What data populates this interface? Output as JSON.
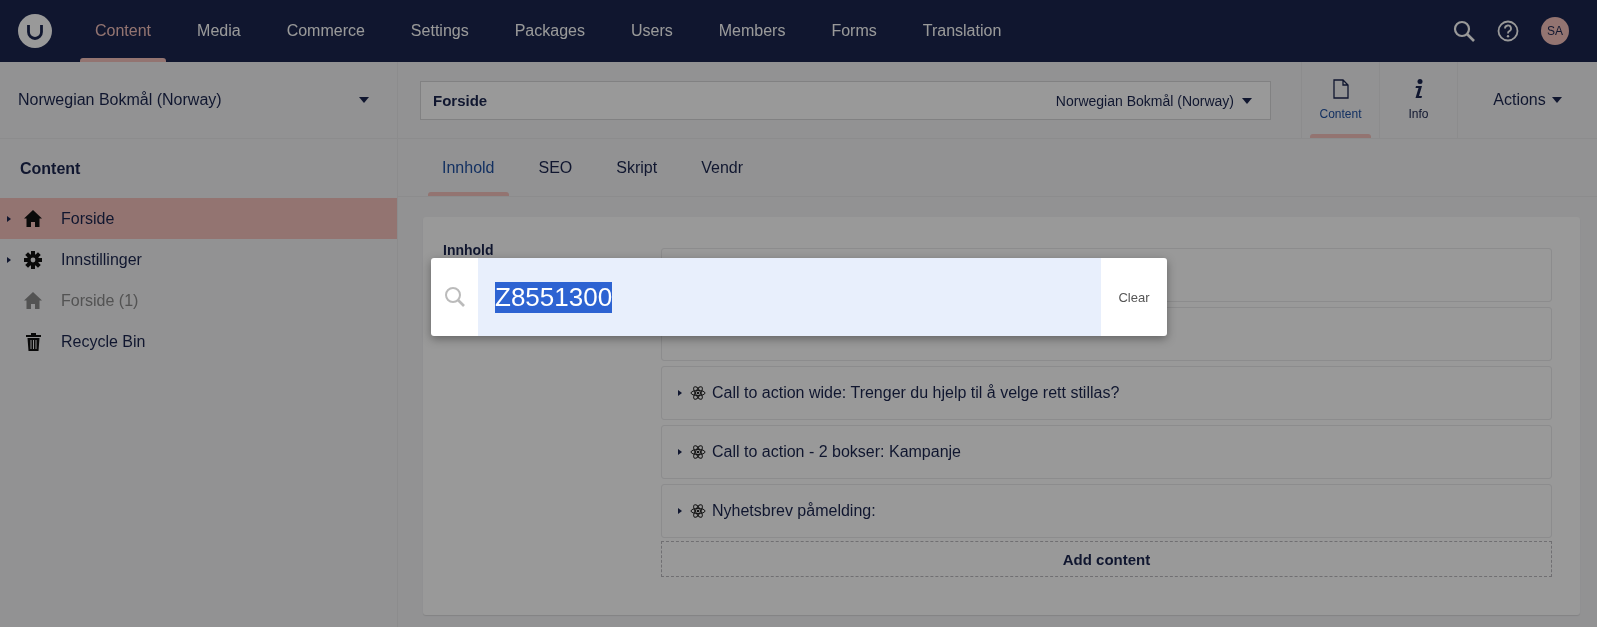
{
  "top_nav": {
    "items": [
      {
        "label": "Content",
        "selected": true
      },
      {
        "label": "Media",
        "selected": false
      },
      {
        "label": "Commerce",
        "selected": false
      },
      {
        "label": "Settings",
        "selected": false
      },
      {
        "label": "Packages",
        "selected": false
      },
      {
        "label": "Users",
        "selected": false
      },
      {
        "label": "Members",
        "selected": false
      },
      {
        "label": "Forms",
        "selected": false
      },
      {
        "label": "Translation",
        "selected": false
      }
    ],
    "avatar": "SA"
  },
  "sidebar": {
    "language": "Norwegian Bokmål (Norway)",
    "title": "Content",
    "tree": [
      {
        "label": "Forside",
        "kind": "home",
        "expandable": true,
        "selected": true,
        "muted": false
      },
      {
        "label": "Innstillinger",
        "kind": "settings",
        "expandable": true,
        "selected": false,
        "muted": false
      },
      {
        "label": "Forside (1)",
        "kind": "home",
        "expandable": false,
        "selected": false,
        "muted": true
      },
      {
        "label": "Recycle Bin",
        "kind": "trash",
        "expandable": false,
        "selected": false,
        "muted": false
      }
    ]
  },
  "editor": {
    "name": "Forside",
    "culture": "Norwegian Bokmål (Norway)",
    "apps": [
      {
        "label": "Content",
        "kind": "document",
        "selected": true
      },
      {
        "label": "Info",
        "kind": "info",
        "selected": false
      }
    ],
    "actions": "Actions",
    "tabs": [
      {
        "label": "Innhold",
        "selected": true
      },
      {
        "label": "SEO",
        "selected": false
      },
      {
        "label": "Skript",
        "selected": false
      },
      {
        "label": "Vendr",
        "selected": false
      }
    ],
    "property_label": "Innhold",
    "blocks": [
      {
        "label": "Call to action wide: Trenger du hjelp til å velge rett stillas?"
      },
      {
        "label": "Call to action - 2 bokser: Kampanje"
      },
      {
        "label": "Nyhetsbrev påmelding:"
      }
    ],
    "add_button": "Add content"
  },
  "search_overlay": {
    "value": "Z8551300",
    "clear": "Clear"
  }
}
